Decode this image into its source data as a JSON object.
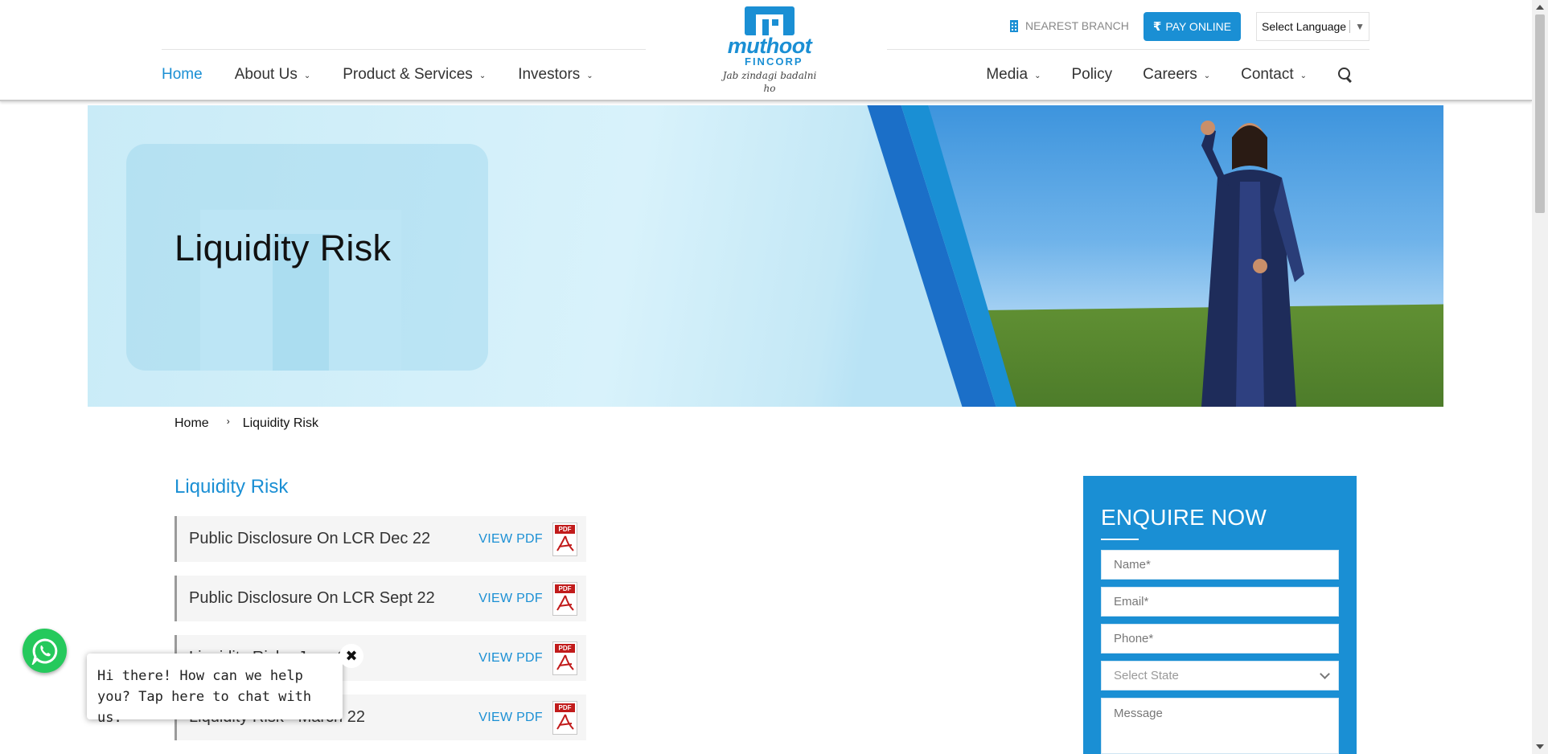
{
  "header": {
    "nearest_branch": "NEAREST BRANCH",
    "pay_online": "PAY ONLINE",
    "language": "Select Language",
    "logo": {
      "brand": "muthoot",
      "sub": "FINCORP",
      "tagline": "Jab zindagi badalni ho"
    },
    "nav_left": [
      {
        "label": "Home",
        "active": true,
        "dropdown": false
      },
      {
        "label": "About Us",
        "dropdown": true
      },
      {
        "label": "Product & Services",
        "dropdown": true
      },
      {
        "label": "Investors",
        "dropdown": true
      }
    ],
    "nav_right": [
      {
        "label": "Media",
        "dropdown": true
      },
      {
        "label": "Policy",
        "dropdown": false
      },
      {
        "label": "Careers",
        "dropdown": true
      },
      {
        "label": "Contact",
        "dropdown": true
      }
    ]
  },
  "banner": {
    "title": "Liquidity Risk"
  },
  "breadcrumb": {
    "home": "Home",
    "current": "Liquidity Risk"
  },
  "section_title": "Liquidity Risk",
  "documents": [
    {
      "title": "Public Disclosure On LCR Dec 22",
      "action": "VIEW PDF",
      "icon": "pdf-icon"
    },
    {
      "title": "Public Disclosure On LCR Sept 22",
      "action": "VIEW PDF",
      "icon": "pdf-icon"
    },
    {
      "title": "Liquidity Risk - June 22",
      "action": "VIEW PDF",
      "icon": "pdf-icon"
    },
    {
      "title": "Liquidity Risk - March 22",
      "action": "VIEW PDF",
      "icon": "pdf-icon"
    }
  ],
  "enquire": {
    "title": "ENQUIRE NOW",
    "name_placeholder": "Name*",
    "email_placeholder": "Email*",
    "phone_placeholder": "Phone*",
    "state_placeholder": "Select State",
    "message_placeholder": "Message"
  },
  "chat": {
    "message": "Hi there! How can we help you? Tap here to chat with us.",
    "close": "✖"
  },
  "colors": {
    "brand_blue": "#1a8fd4",
    "whatsapp_green": "#25c95c"
  }
}
